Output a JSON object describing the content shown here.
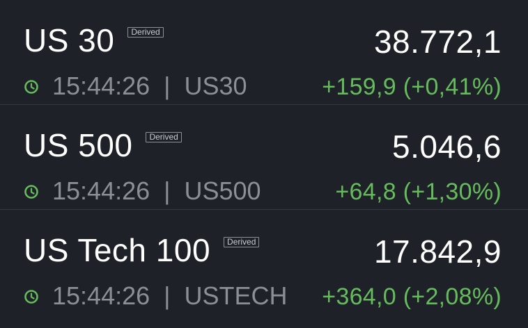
{
  "colors": {
    "background": "#1e2228",
    "positive": "#66bb5c",
    "muted_text": "#8c9096",
    "primary_text": "#ffffff"
  },
  "instruments": [
    {
      "name": "US 30",
      "badge": "Derived",
      "price": "38.772,1",
      "time": "15:44:26",
      "separator": "|",
      "symbol": "US30",
      "change": "+159,9 (+0,41%)",
      "icon": "clock-icon"
    },
    {
      "name": "US 500",
      "badge": "Derived",
      "price": "5.046,6",
      "time": "15:44:26",
      "separator": "|",
      "symbol": "US500",
      "change": "+64,8 (+1,30%)",
      "icon": "clock-icon"
    },
    {
      "name": "US Tech 100",
      "badge": "Derived",
      "price": "17.842,9",
      "time": "15:44:26",
      "separator": "|",
      "symbol": "USTECH",
      "change": "+364,0 (+2,08%)",
      "icon": "clock-icon"
    }
  ]
}
